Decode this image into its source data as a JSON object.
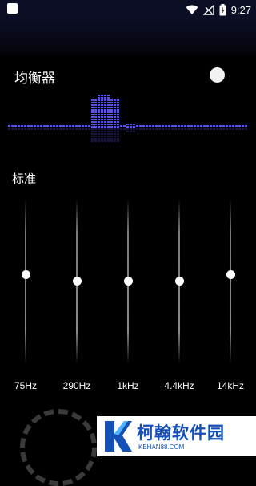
{
  "status_bar": {
    "time": "9:27"
  },
  "equalizer": {
    "title": "均衡器",
    "enabled_toggle": "on",
    "preset": "标准",
    "bands": [
      {
        "label": "75Hz",
        "level": 0.54
      },
      {
        "label": "290Hz",
        "level": 0.5
      },
      {
        "label": "1kHz",
        "level": 0.5
      },
      {
        "label": "4.4kHz",
        "level": 0.5
      },
      {
        "label": "14kHz",
        "level": 0.54
      }
    ],
    "accent_color": "#5a55d6"
  },
  "watermark": {
    "text": "柯翰软件园",
    "sub": "KEHAN88.COM",
    "color": "#1550b7"
  }
}
